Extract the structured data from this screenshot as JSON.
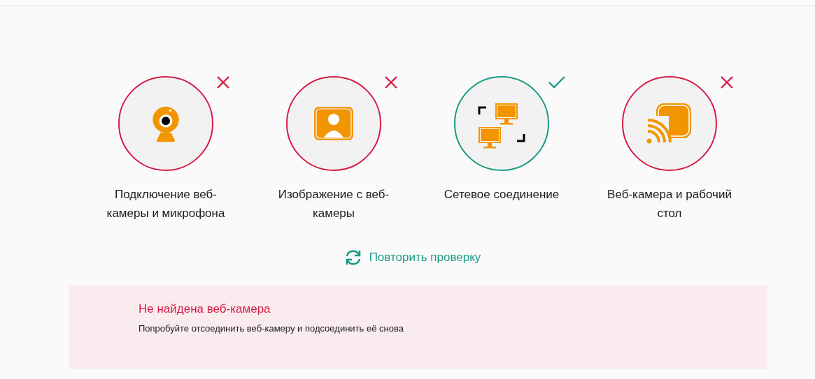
{
  "checks": [
    {
      "kind": "webcam",
      "label": "Подключение веб-камеры и микрофона",
      "passed": false
    },
    {
      "kind": "image",
      "label": "Изображение с веб-камеры",
      "passed": false
    },
    {
      "kind": "network",
      "label": "Сетевое соединение",
      "passed": true
    },
    {
      "kind": "screen",
      "label": "Веб-камера и рабочий стол",
      "passed": false
    }
  ],
  "retry": {
    "label": "Повторить проверку"
  },
  "alert": {
    "title": "Не найдена веб-камера",
    "message": "Попробуйте отсоединить веб-камеру и подсоединить её снова"
  }
}
